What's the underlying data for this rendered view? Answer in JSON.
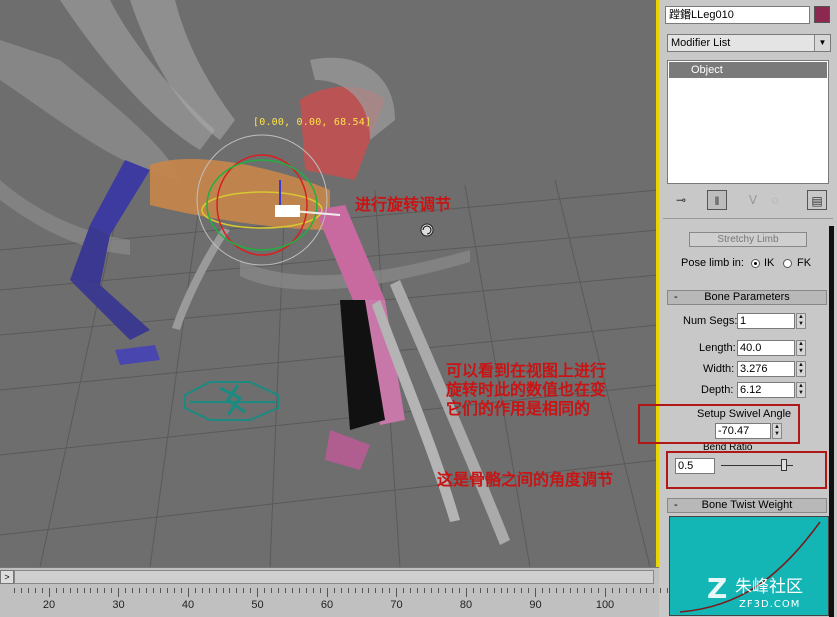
{
  "viewport": {
    "coord_readout": "[0.00, 0.00, 68.54]",
    "gizmo_axis_label": "z"
  },
  "annotations": {
    "rotate_note": "进行旋转调节",
    "same_value_note": [
      "可以看到在视图上进行",
      "旋转时此的数值也在变",
      "它们的作用是相同的"
    ],
    "bone_angle_note": "这是骨骼之间的角度调节"
  },
  "panel": {
    "object_name": "蹚鍲LLeg010",
    "object_color": "#8c2850",
    "modifier_list_label": "Modifier List",
    "stack_items": [
      "Object"
    ],
    "toolbar_icons": [
      "pin-stack-icon",
      "show-end-result-icon",
      "make-unique-icon",
      "remove-modifier-icon",
      "configure-modifier-sets-icon"
    ],
    "stretchy_limb_button": "Stretchy Limb",
    "pose_limb_label": "Pose limb in:",
    "pose_options": [
      "IK",
      "FK"
    ],
    "pose_selected": "IK",
    "bone_params": {
      "header": "Bone Parameters",
      "collapse_symbol": "-",
      "num_segs_label": "Num Segs:",
      "num_segs_value": "1",
      "length_label": "Length:",
      "length_value": "40.0",
      "width_label": "Width:",
      "width_value": "3.276",
      "depth_label": "Depth:",
      "depth_value": "6.12",
      "swivel_label": "Setup Swivel Angle",
      "swivel_value": "-70.47",
      "bend_ratio_label": "Bend Ratio",
      "bend_ratio_value": "0.5",
      "bend_ratio_slider_fraction": 0.85
    },
    "bone_twist": {
      "header": "Bone Twist Weight",
      "collapse_symbol": "-"
    }
  },
  "timeline": {
    "ruler_labels": [
      "20",
      "30",
      "40",
      "50",
      "60",
      "70",
      "80",
      "90",
      "100"
    ],
    "slider_arrow": ">"
  },
  "watermark": {
    "text_cn": "朱峰社区",
    "text_en": "ZF3D.COM"
  },
  "colors": {
    "viewport_bg": "#6e6e6e",
    "annotation_red": "#c81414",
    "frame_yellow": "#e8d500",
    "graph_cyan": "#13b5b5"
  }
}
